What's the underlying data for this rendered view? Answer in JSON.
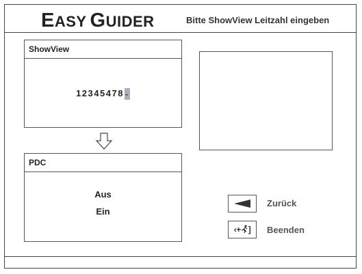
{
  "header": {
    "logo_E": "E",
    "logo_ASY": "ASY",
    "logo_G": "G",
    "logo_UIDER": "UIDER",
    "instruction": "Bitte ShowView Leitzahl eingeben"
  },
  "showview": {
    "title": "ShowView",
    "code": "12345478",
    "cursor": "-"
  },
  "pdc": {
    "title": "PDC",
    "options": [
      "Aus",
      "Ein"
    ]
  },
  "nav": {
    "back_label": "Zurück",
    "exit_label": "Beenden",
    "exit_glyph_left": "‹+",
    "exit_glyph_right": "]"
  },
  "icons": {
    "down_arrow": "down-arrow-icon",
    "back": "back-arrow-icon",
    "exit": "exit-run-icon"
  },
  "colors": {
    "cursor_highlight": "#a9b0bc",
    "border": "#444444"
  }
}
